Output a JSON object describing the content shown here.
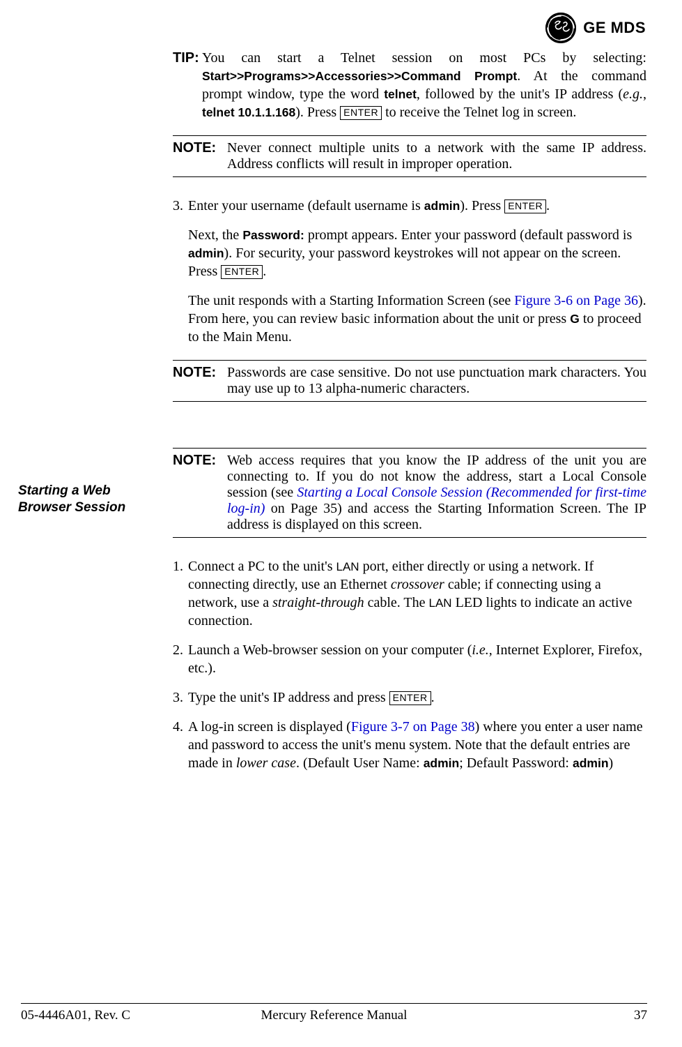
{
  "header": {
    "brand": "GE MDS"
  },
  "tip": {
    "label": "TIP:",
    "body_pre": " You can start a Telnet session on most PCs by selecting: ",
    "path": "Start>>Programs>>Accessories>>Command Prompt",
    "body_mid1": ". At the command prompt window, type the word ",
    "telnet_word": "telnet",
    "body_mid2": ", followed by the unit's IP address (",
    "eg": "e.g.",
    "comma": ", ",
    "telnet_ex": "telnet 10.1.1.168",
    "body_mid3": "). Press ",
    "enter": "ENTER",
    "body_end": " to receive the Telnet log in screen."
  },
  "note1": {
    "label": "NOTE:",
    "text": "Never connect multiple units to a network with the same IP address. Address conflicts will result in improper operation."
  },
  "step3": {
    "num": "3.",
    "t1": "Enter your username (default username is ",
    "admin": "admin",
    "t2": "). Press ",
    "enter": "ENTER",
    "t3": "."
  },
  "pass_para": {
    "t1": "Next, the ",
    "pw": "Password:",
    "t2": " prompt appears. Enter your password (default password is ",
    "admin": "admin",
    "t3": "). For security, your password keystrokes will not appear on the screen. Press ",
    "enter": "ENTER",
    "t4": "."
  },
  "resp_para": {
    "t1": "The unit responds with a Starting Information Screen (see ",
    "link": "Figure 3-6 on Page 36",
    "t2": "). From here, you can review basic information about the unit or press ",
    "g": "G",
    "t3": " to proceed to the Main Menu."
  },
  "note2": {
    "label": "NOTE:",
    "text": "Passwords are case sensitive. Do not use punctuation mark characters. You may use up to 13 alpha-numeric characters."
  },
  "sidehead_web": "Starting a Web Browser Session",
  "note3": {
    "label": "NOTE:",
    "t1": "Web access requires that you know the IP address of the unit you are connecting to. If you do not know the address, start a Local Console session (see ",
    "link": "Starting a Local Console Session (Recommended for first-time log-in)",
    "t2": " on Page 35) and access the Starting Information Screen. The IP address is displayed on this screen."
  },
  "wstep1": {
    "num": "1.",
    "t1": "Connect a PC to the unit's ",
    "lan": "LAN",
    "t2": " port, either directly or using a network. If connecting directly, use an Ethernet ",
    "cross": "crossover",
    "t3": " cable; if connecting using a network, use a ",
    "st": "straight-through",
    "t4": " cable. The ",
    "lan2": "LAN",
    "t5": " LED lights to indicate an active connection."
  },
  "wstep2": {
    "num": "2.",
    "t1": "Launch a Web-browser session on your computer (",
    "ie": "i.e.,",
    "t2": " Internet Explorer, Firefox, etc.)."
  },
  "wstep3": {
    "num": "3.",
    "t1": "Type the unit's IP address and press ",
    "enter": "ENTER",
    "t2": "."
  },
  "wstep4": {
    "num": "4.",
    "t1": "A log-in screen is displayed (",
    "link": "Figure 3-7 on Page 38",
    "t2": ") where you enter a user name and password to access the unit's menu system. Note that the default entries are made in ",
    "lc": "lower case",
    "t3": ". (Default User Name: ",
    "admin1": "admin",
    "t4": "; Default Password: ",
    "admin2": "admin",
    "t5": ")"
  },
  "footer": {
    "left": "05-4446A01, Rev. C",
    "center": "Mercury Reference Manual",
    "right": "37"
  }
}
